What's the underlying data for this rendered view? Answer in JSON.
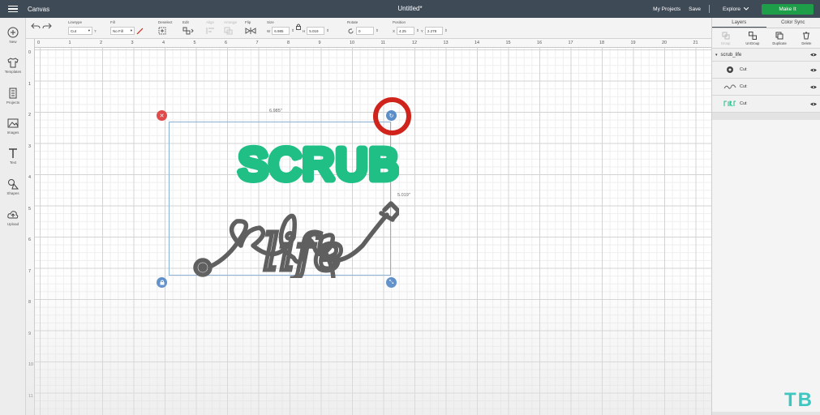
{
  "topbar": {
    "app_title": "Canvas",
    "doc_title": "Untitled*",
    "my_projects": "My Projects",
    "save": "Save",
    "explore": "Explore",
    "make_it": "Make It"
  },
  "sidebar": {
    "items": [
      {
        "label": "New",
        "icon": "plus-circle-icon"
      },
      {
        "label": "Templates",
        "icon": "shirt-icon"
      },
      {
        "label": "Projects",
        "icon": "projects-icon"
      },
      {
        "label": "Images",
        "icon": "image-icon"
      },
      {
        "label": "Text",
        "icon": "text-t-icon"
      },
      {
        "label": "Shapes",
        "icon": "shapes-icon"
      },
      {
        "label": "Upload",
        "icon": "cloud-upload-icon"
      }
    ]
  },
  "toolbar": {
    "linetype_label": "Linetype",
    "linetype_value": "Cut",
    "fill_label": "Fill",
    "fill_value": "No Fill",
    "deselect_label": "Deselect",
    "edit_label": "Edit",
    "align_label": "Align",
    "arrange_label": "Arrange",
    "flip_label": "Flip",
    "size_label": "Size",
    "w_label": "W",
    "w_value": "6.985",
    "h_label": "H",
    "h_value": "5.019",
    "rotate_label": "Rotate",
    "rotate_value": "0",
    "position_label": "Position",
    "x_label": "X",
    "x_value": "4.25",
    "y_label": "Y",
    "y_value": "2.278"
  },
  "right_panel": {
    "tabs": [
      "Layers",
      "Color Sync"
    ],
    "actions": [
      {
        "label": "Group",
        "enabled": false
      },
      {
        "label": "UnGroup",
        "enabled": true
      },
      {
        "label": "Duplicate",
        "enabled": true
      },
      {
        "label": "Delete",
        "enabled": true
      }
    ],
    "group_name": "scrub_life",
    "layers": [
      {
        "name": "Cut",
        "thumb": "stethoscope-ring"
      },
      {
        "name": "Cut",
        "thumb": "life-text"
      },
      {
        "name": "Cut",
        "thumb": "scrub-text"
      }
    ]
  },
  "canvas": {
    "ruler_top": [
      "0",
      "1",
      "2",
      "3",
      "4",
      "5",
      "6",
      "7",
      "8",
      "9",
      "10",
      "11",
      "12",
      "13",
      "14",
      "15",
      "16",
      "17",
      "18",
      "19",
      "20",
      "21"
    ],
    "ruler_left": [
      "0",
      "1",
      "2",
      "3",
      "4",
      "5",
      "6",
      "7",
      "8",
      "9",
      "10",
      "11"
    ],
    "width_dim": "6.985\"",
    "height_dim": "5.019\"",
    "design_scrub": "SCRUB",
    "design_life": "life"
  },
  "colors": {
    "topbar": "#3f4a57",
    "make_it": "#1f9e49",
    "scrub_green": "#1fbf86",
    "life_gray": "#5f5f5f",
    "highlight_red": "#d0231b",
    "watermark": "#3ec7c0"
  },
  "watermark": "TB"
}
